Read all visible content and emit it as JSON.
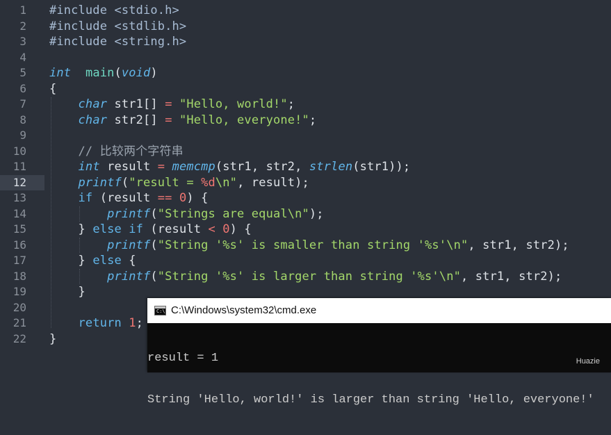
{
  "editor": {
    "active_line": 12,
    "lines": [
      {
        "n": "1",
        "t": [
          [
            "pp",
            "#include <stdio.h>"
          ]
        ]
      },
      {
        "n": "2",
        "t": [
          [
            "pp",
            "#include <stdlib.h>"
          ]
        ]
      },
      {
        "n": "3",
        "t": [
          [
            "pp",
            "#include <string.h>"
          ]
        ]
      },
      {
        "n": "4",
        "t": []
      },
      {
        "n": "5",
        "t": [
          [
            "ty",
            "int"
          ],
          [
            "",
            "  "
          ],
          [
            "fnn",
            "main"
          ],
          [
            "",
            "("
          ],
          [
            "ty",
            "void"
          ],
          [
            "",
            ")"
          ]
        ]
      },
      {
        "n": "6",
        "t": [
          [
            "",
            "{"
          ]
        ]
      },
      {
        "n": "7",
        "t": [
          [
            "",
            "    "
          ],
          [
            "ty",
            "char"
          ],
          [
            "",
            " str1[] "
          ],
          [
            "op",
            "="
          ],
          [
            "",
            " "
          ],
          [
            "str",
            "\"Hello, world!\""
          ],
          [
            "",
            ";"
          ]
        ]
      },
      {
        "n": "8",
        "t": [
          [
            "",
            "    "
          ],
          [
            "ty",
            "char"
          ],
          [
            "",
            " str2[] "
          ],
          [
            "op",
            "="
          ],
          [
            "",
            " "
          ],
          [
            "str",
            "\"Hello, everyone!\""
          ],
          [
            "",
            ";"
          ]
        ]
      },
      {
        "n": "9",
        "t": []
      },
      {
        "n": "10",
        "t": [
          [
            "",
            "    "
          ],
          [
            "cm",
            "// 比较两个字符串"
          ]
        ]
      },
      {
        "n": "11",
        "t": [
          [
            "",
            "    "
          ],
          [
            "ty",
            "int"
          ],
          [
            "",
            " result "
          ],
          [
            "op",
            "="
          ],
          [
            "",
            " "
          ],
          [
            "fn",
            "memcmp"
          ],
          [
            "",
            "(str1, str2, "
          ],
          [
            "fn",
            "strlen"
          ],
          [
            "",
            "(str1));"
          ]
        ]
      },
      {
        "n": "12",
        "t": [
          [
            "",
            "    "
          ],
          [
            "fn",
            "printf"
          ],
          [
            "",
            "("
          ],
          [
            "str",
            "\"result = "
          ],
          [
            "op",
            "%d"
          ],
          [
            "esc",
            "\\n"
          ],
          [
            "str",
            "\""
          ],
          [
            "",
            ", result);"
          ]
        ]
      },
      {
        "n": "13",
        "t": [
          [
            "",
            "    "
          ],
          [
            "kw",
            "if"
          ],
          [
            "",
            " (result "
          ],
          [
            "op",
            "=="
          ],
          [
            "",
            " "
          ],
          [
            "num",
            "0"
          ],
          [
            "",
            ") {"
          ]
        ]
      },
      {
        "n": "14",
        "t": [
          [
            "",
            "        "
          ],
          [
            "fn",
            "printf"
          ],
          [
            "",
            "("
          ],
          [
            "str",
            "\"Strings are equal"
          ],
          [
            "esc",
            "\\n"
          ],
          [
            "str",
            "\""
          ],
          [
            "",
            ");"
          ]
        ]
      },
      {
        "n": "15",
        "t": [
          [
            "",
            "    } "
          ],
          [
            "kw",
            "else if"
          ],
          [
            "",
            " (result "
          ],
          [
            "op",
            "<"
          ],
          [
            "",
            " "
          ],
          [
            "num",
            "0"
          ],
          [
            "",
            ") {"
          ]
        ]
      },
      {
        "n": "16",
        "t": [
          [
            "",
            "        "
          ],
          [
            "fn",
            "printf"
          ],
          [
            "",
            "("
          ],
          [
            "str",
            "\"String '%s' is smaller than string '%s'"
          ],
          [
            "esc",
            "\\n"
          ],
          [
            "str",
            "\""
          ],
          [
            "",
            ", str1, str2);"
          ]
        ]
      },
      {
        "n": "17",
        "t": [
          [
            "",
            "    } "
          ],
          [
            "kw",
            "else"
          ],
          [
            "",
            " {"
          ]
        ]
      },
      {
        "n": "18",
        "t": [
          [
            "",
            "        "
          ],
          [
            "fn",
            "printf"
          ],
          [
            "",
            "("
          ],
          [
            "str",
            "\"String '%s' is larger than string '%s'"
          ],
          [
            "esc",
            "\\n"
          ],
          [
            "str",
            "\""
          ],
          [
            "",
            ", str1, str2);"
          ]
        ]
      },
      {
        "n": "19",
        "t": [
          [
            "",
            "    }"
          ]
        ]
      },
      {
        "n": "20",
        "t": []
      },
      {
        "n": "21",
        "t": [
          [
            "",
            "    "
          ],
          [
            "kw",
            "return"
          ],
          [
            "",
            " "
          ],
          [
            "num",
            "1"
          ],
          [
            "",
            ";"
          ]
        ]
      },
      {
        "n": "22",
        "t": [
          [
            "",
            "}"
          ]
        ]
      }
    ]
  },
  "console": {
    "icon": "cmd-icon",
    "icon_text": "C:\\",
    "title": "C:\\Windows\\system32\\cmd.exe",
    "output": [
      "result = 1",
      "String 'Hello, world!' is larger than string 'Hello, everyone!'"
    ],
    "watermark": "Huazie"
  }
}
